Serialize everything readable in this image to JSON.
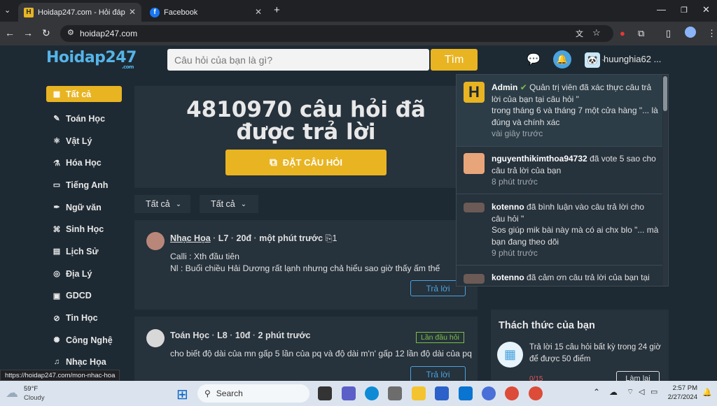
{
  "browser": {
    "tabs": [
      {
        "title": "Hoidap247.com - Hỏi đáp bài tập",
        "favicon": "H"
      },
      {
        "title": "Facebook",
        "favicon": "f"
      }
    ],
    "url": "hoidap247.com",
    "status_url": "https://hoidap247.com/mon-nhac-hoa"
  },
  "header": {
    "logo": "Hoidap247",
    "logo_suffix": ".com",
    "search_placeholder": "Câu hỏi của bạn là gì?",
    "search_button": "Tìm",
    "username": "huunghia62 ..."
  },
  "sidebar": {
    "items": [
      {
        "label": "Tất cả",
        "icon": "grid-icon"
      },
      {
        "label": "Toán Học",
        "icon": "math-icon"
      },
      {
        "label": "Vật Lý",
        "icon": "physics-icon"
      },
      {
        "label": "Hóa Học",
        "icon": "chemistry-icon"
      },
      {
        "label": "Tiếng Anh",
        "icon": "english-icon"
      },
      {
        "label": "Ngữ văn",
        "icon": "pen-icon"
      },
      {
        "label": "Sinh Học",
        "icon": "dna-icon"
      },
      {
        "label": "Lịch Sử",
        "icon": "history-icon"
      },
      {
        "label": "Địa Lý",
        "icon": "globe-icon"
      },
      {
        "label": "GDCD",
        "icon": "gdcd-icon"
      },
      {
        "label": "Tin Học",
        "icon": "computer-icon"
      },
      {
        "label": "Công Nghệ",
        "icon": "tech-icon"
      },
      {
        "label": "Nhạc Họa",
        "icon": "music-icon"
      }
    ]
  },
  "hero": {
    "title_line1": "4810970 câu hỏi đã",
    "title_line2": "được trả lời",
    "ask_button": "ĐẶT CÂU HỎI"
  },
  "filters": [
    "Tất cả",
    "Tất cả"
  ],
  "questions": [
    {
      "subject": "Nhạc Họa",
      "level": "L7",
      "points": "20đ",
      "time": "một phút trước",
      "attachments": "1",
      "line1": "Calli : Xth đầu tiên",
      "line2": "Nl : Buổi chiều Hải Dương rất lạnh nhưng chả hiểu sao giờ thấy ấm thế",
      "reply": "Trả lời"
    },
    {
      "subject": "Toán Học",
      "level": "L8",
      "points": "10đ",
      "time": "2 phút trước",
      "tag": "Lần đầu hỏi",
      "line1": "cho biết độ dài của mn gấp 5 lần của pq và độ dài m'n' gấp 12 lần độ dài của pq",
      "reply": "Trả lời"
    }
  ],
  "challenge": {
    "title": "Thách thức của bạn",
    "line1": "Trả lời 15 câu hỏi  bất kỳ  trong 24 giờ",
    "line2": "để được 50 điểm",
    "progress": "0/15",
    "button": "Làm lại"
  },
  "notifications": [
    {
      "user": "Admin",
      "action": "Quản trị viên đã xác thực câu trả lời của bạn tại câu hỏi \"",
      "excerpt": "trong tháng 6 và tháng 7 một cửa hàng \"... là đúng và chính xác",
      "time": "vài giây trước"
    },
    {
      "user": "nguyenthikimthoa94732",
      "action": "đã vote 5 sao cho câu trả lời của bạn",
      "time": "8 phút trước"
    },
    {
      "user": "kotenno",
      "action": "đã bình luận vào câu trả lời cho câu hỏi \"",
      "excerpt": "Sos giúp mik bài này mà có ai chx blo \"... mà bạn đang theo dõi",
      "time": "9 phút trước"
    },
    {
      "user": "kotenno",
      "action": "đã cảm ơn câu trả lời của bạn tại"
    }
  ],
  "taskbar": {
    "weather_temp": "59°F",
    "weather_desc": "Cloudy",
    "search_label": "Search",
    "time": "2:57 PM",
    "date": "2/27/2024"
  }
}
